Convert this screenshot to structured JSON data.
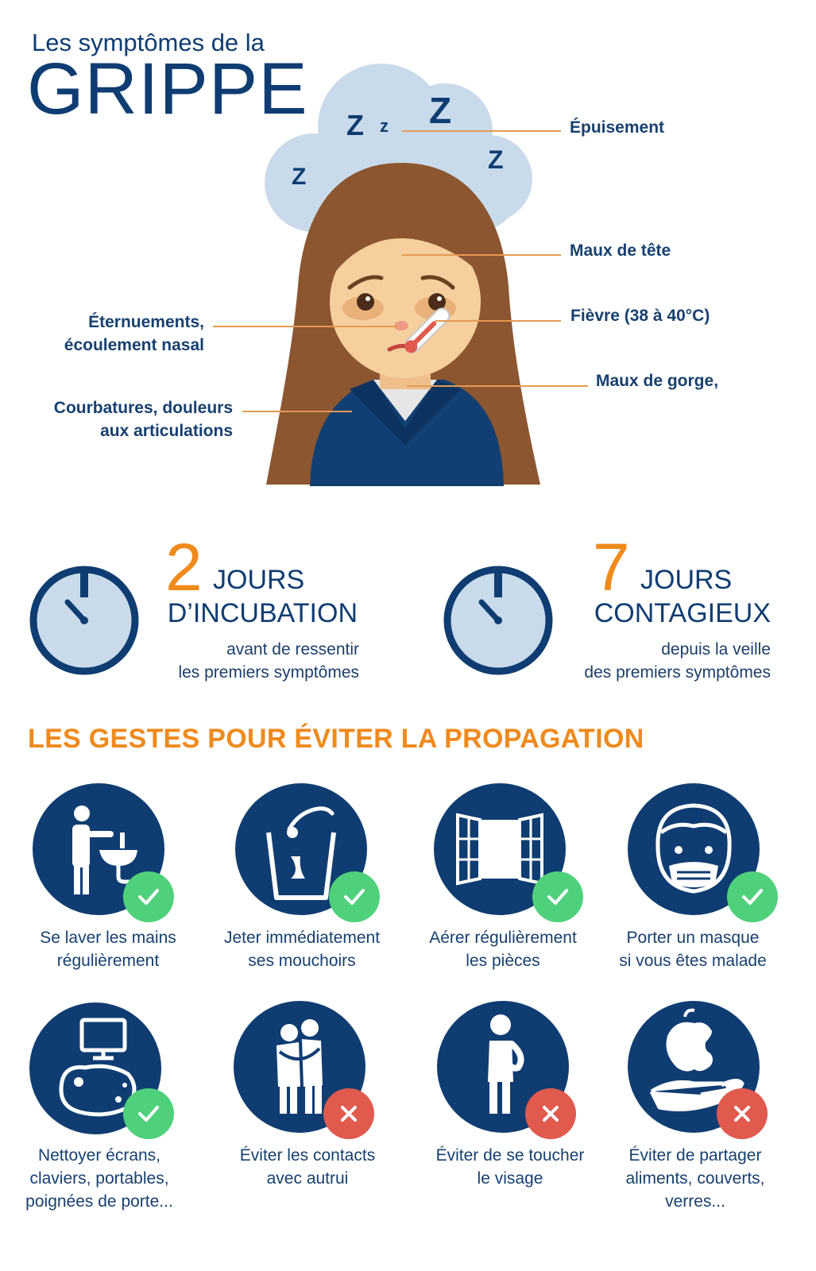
{
  "title": {
    "line1": "Les symptômes de la",
    "line2": "GRIPPE"
  },
  "colors": {
    "navy": "#0f3d72",
    "orange": "#ef8a1c",
    "hair": "#8b5630",
    "skin": "#f7cf9e",
    "cloud": "#c9dbea",
    "ok_green": "#4fd17c",
    "no_red": "#e05a4e"
  },
  "symptoms": {
    "epuisement": "Épuisement",
    "maux_tete": "Maux de tête",
    "fievre": "Fièvre (38 à 40°C)",
    "gorge": "Maux de gorge,",
    "eternuements_1": "Éternuements,",
    "eternuements_2": "écoulement nasal",
    "courbatures_1": "Courbatures, douleurs",
    "courbatures_2": "aux articulations"
  },
  "sleep_letters": [
    "Z",
    "z",
    "Z",
    "Z",
    "Z"
  ],
  "stats": {
    "incubation": {
      "number": "2",
      "unit": "JOURS",
      "heading": "D’INCUBATION",
      "desc_1": "avant de ressentir",
      "desc_2": "les premiers symptômes"
    },
    "contagieux": {
      "number": "7",
      "unit": "JOURS",
      "heading": "CONTAGIEUX",
      "desc_1": "depuis la veille",
      "desc_2": "des premiers symptômes"
    }
  },
  "section_title": "LES GESTES POUR ÉVITER LA PROPAGATION",
  "gestures": [
    {
      "icon": "handwash-icon",
      "status": "ok",
      "line1": "Se laver les mains",
      "line2": "régulièrement",
      "line3": ""
    },
    {
      "icon": "tissue-bin-icon",
      "status": "ok",
      "line1": "Jeter immédiatement",
      "line2": "ses mouchoirs",
      "line3": ""
    },
    {
      "icon": "open-window-icon",
      "status": "ok",
      "line1": "Aérer régulièrement",
      "line2": "les pièces",
      "line3": ""
    },
    {
      "icon": "face-mask-icon",
      "status": "ok",
      "line1": "Porter un masque",
      "line2": "si vous êtes malade",
      "line3": ""
    },
    {
      "icon": "clean-screen-icon",
      "status": "ok",
      "line1": "Nettoyer écrans,",
      "line2": "claviers, portables,",
      "line3": "poignées de porte..."
    },
    {
      "icon": "hug-icon",
      "status": "no",
      "line1": "Éviter les contacts",
      "line2": "avec autrui",
      "line3": ""
    },
    {
      "icon": "touch-face-icon",
      "status": "no",
      "line1": "Éviter de se toucher",
      "line2": "le visage",
      "line3": ""
    },
    {
      "icon": "share-apple-icon",
      "status": "no",
      "line1": "Éviter de partager",
      "line2": "aliments, couverts,",
      "line3": "verres..."
    }
  ]
}
